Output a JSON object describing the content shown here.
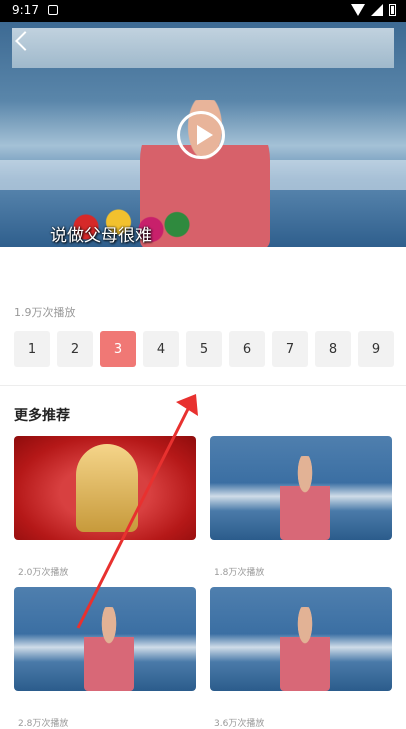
{
  "status_bar": {
    "time": "9:17"
  },
  "player": {
    "caption": "说做父母很难"
  },
  "info": {
    "plays": "1.9万次播放"
  },
  "episodes": {
    "items": [
      "1",
      "2",
      "3",
      "4",
      "5",
      "6",
      "7",
      "8",
      "9"
    ],
    "active_index": 2
  },
  "recommend": {
    "title": "更多推荐",
    "cards": [
      {
        "plays": "2.0万次播放",
        "thumb": "red"
      },
      {
        "plays": "1.8万次播放",
        "thumb": "blue"
      },
      {
        "plays": "2.8万次播放",
        "thumb": "blue"
      },
      {
        "plays": "3.6万次播放",
        "thumb": "blue"
      }
    ]
  },
  "colors": {
    "accent": "#f07875",
    "arrow": "#e8312f"
  }
}
